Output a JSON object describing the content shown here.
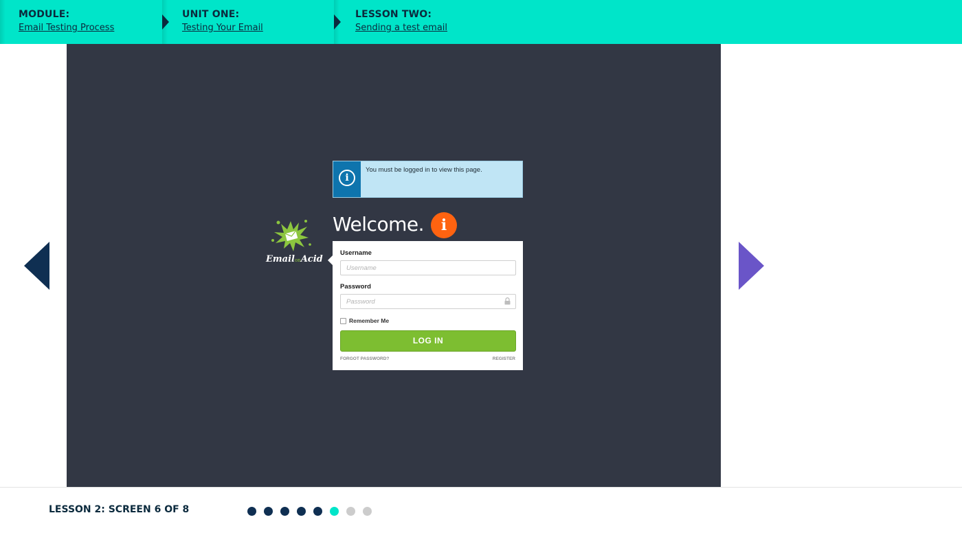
{
  "breadcrumb": {
    "module": {
      "title": "MODULE:",
      "link": "Email Testing Process"
    },
    "unit": {
      "title": "UNIT ONE:",
      "link": "Testing Your Email"
    },
    "lesson": {
      "title": "LESSON TWO:",
      "link": "Sending a test email"
    }
  },
  "stage": {
    "alert_text": "You must be logged in to view this page.",
    "alert_icon": "info-circle-icon",
    "logo": {
      "name": "Email on Acid",
      "text_main_1": "Email",
      "text_on": "on",
      "text_main_2": "Acid"
    },
    "welcome": "Welcome.",
    "info_badge": "i",
    "form": {
      "username_label": "Username",
      "username_placeholder": "Username",
      "password_label": "Password",
      "password_placeholder": "Password",
      "remember_label": "Remember Me",
      "login_button": "LOG IN",
      "forgot_link": "FORGOT PASSWORD?",
      "register_link": "REGISTER"
    }
  },
  "footer": {
    "screen_label": "LESSON 2: SCREEN 6 OF 8",
    "current_screen": 6,
    "total_screens": 8
  },
  "colors": {
    "accent": "#00e5c9",
    "navy": "#0f2f52",
    "next_arrow": "#6a55c8",
    "stage_bg": "#323744",
    "login_green": "#7dbe31",
    "info_orange": "#ff6310",
    "dot_done": "#0f2f52",
    "dot_current": "#00e5c9",
    "dot_todo": "#cccccc"
  }
}
